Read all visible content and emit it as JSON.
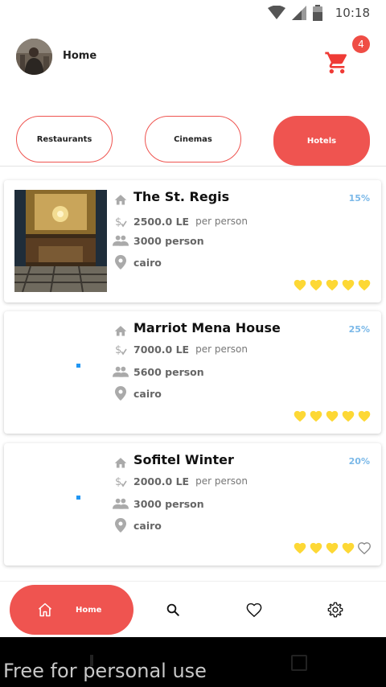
{
  "status_bar": {
    "time": "10:18"
  },
  "header": {
    "title": "Home",
    "cart_count": "4"
  },
  "categories": [
    {
      "label": "Restaurants",
      "active": false
    },
    {
      "label": "Cinemas",
      "active": false
    },
    {
      "label": "Hotels",
      "active": true
    }
  ],
  "hotels": [
    {
      "name": "The St. Regis",
      "discount": "15%",
      "price": "2500.0 LE",
      "price_unit": "per person",
      "capacity": "3000 person",
      "location": "cairo",
      "rating": 5
    },
    {
      "name": "Marriot Mena House",
      "discount": "25%",
      "price": "7000.0 LE",
      "price_unit": "per person",
      "capacity": "5600 person",
      "location": "cairo",
      "rating": 5
    },
    {
      "name": "Sofitel Winter",
      "discount": "20%",
      "price": "2000.0 LE",
      "price_unit": "per person",
      "capacity": "3000 person",
      "location": "cairo",
      "rating": 4
    }
  ],
  "bottom_nav": {
    "home_label": "Home"
  },
  "watermark": "Free for personal use",
  "colors": {
    "accent": "#ef5450",
    "star": "#fdd835",
    "discount": "#7ab8e8"
  }
}
